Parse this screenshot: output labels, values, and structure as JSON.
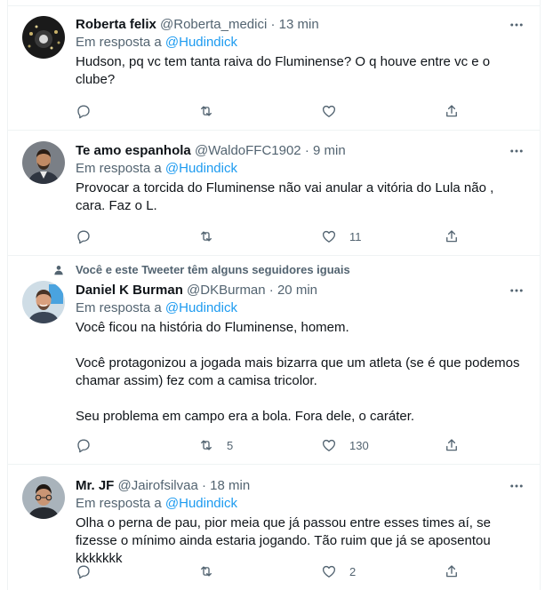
{
  "labels": {
    "replying_to": "Em resposta a"
  },
  "colors": {
    "accent": "#1d9bf0",
    "secondary_text": "#536471",
    "primary_text": "#0f1419",
    "divider": "#eff3f4"
  },
  "tweets": [
    {
      "name": "Roberta felix",
      "handle": "@Roberta_medici",
      "separator": "·",
      "time": "13 min",
      "reply_to": "@Hudindick",
      "paragraphs": [
        "Hudson, pq vc tem tanta raiva do Fluminense? O q houve entre vc e o clube?"
      ],
      "replies": "",
      "retweets": "",
      "likes": "",
      "avatar": "dark-lights-avatar"
    },
    {
      "name": "Te amo espanhola",
      "handle": "@WaldoFFC1902",
      "separator": "·",
      "time": "9 min",
      "reply_to": "@Hudindick",
      "paragraphs": [
        "Provocar a torcida do Fluminense não vai anular a vitória do Lula não , cara. Faz o L."
      ],
      "replies": "",
      "retweets": "",
      "likes": "11",
      "avatar": "man-in-suit-avatar"
    },
    {
      "social_context": "Você e este Tweeter têm alguns seguidores iguais",
      "name": "Daniel K Burman",
      "handle": "@DKBurman",
      "separator": "·",
      "time": "20 min",
      "reply_to": "@Hudindick",
      "paragraphs": [
        "Você ficou na história do Fluminense, homem.",
        "",
        "Você protagonizou a jogada mais bizarra que um atleta (se é que podemos chamar assim) fez com a camisa tricolor.",
        "",
        "Seu problema em campo era a bola. Fora dele, o caráter."
      ],
      "replies": "",
      "retweets": "5",
      "likes": "130",
      "avatar": "smiling-man-avatar"
    },
    {
      "name": "Mr. JF",
      "handle": "@Jairofsilvaa",
      "separator": "·",
      "time": "18 min",
      "reply_to": "@Hudindick",
      "paragraphs": [
        "Olha o perna de pau, pior meia que já passou entre esses times aí, se fizesse o mínimo ainda estaria jogando. Tão ruim que já se aposentou kkkkkkk"
      ],
      "replies": "",
      "retweets": "",
      "likes": "2",
      "avatar": "young-man-avatar"
    }
  ]
}
